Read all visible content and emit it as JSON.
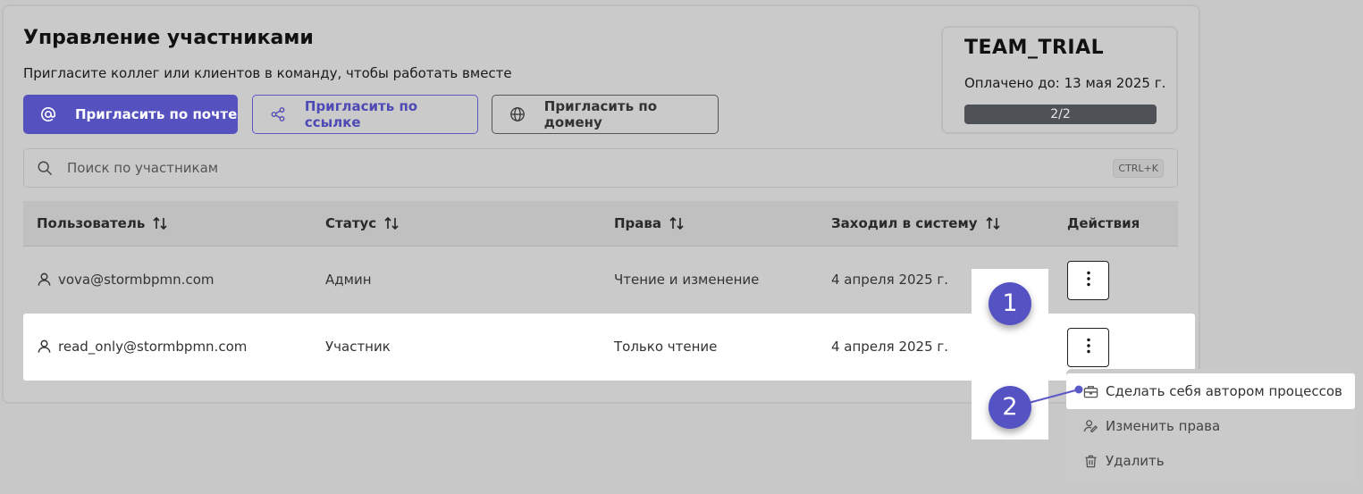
{
  "header": {
    "title": "Управление участниками",
    "subtitle": "Пригласите коллег или клиентов в команду, чтобы работать вместе"
  },
  "invite": {
    "email_label": "Пригласить по почте",
    "link_label": "Пригласить по ссылке",
    "domain_label": "Пригласить по домену"
  },
  "plan": {
    "name": "TEAM_TRIAL",
    "paid_until": "Оплачено до: 13 мая 2025 г.",
    "seats": "2/2"
  },
  "search": {
    "placeholder": "Поиск по участникам",
    "shortcut": "CTRL+K"
  },
  "table": {
    "columns": [
      "Пользователь",
      "Статус",
      "Права",
      "Заходил в систему",
      "Действия"
    ],
    "rows": [
      {
        "user": "vova@stormbpmn.com",
        "status": "Админ",
        "rights": "Чтение и изменение",
        "last_login": "4 апреля 2025 г."
      },
      {
        "user": "read_only@stormbpmn.com",
        "status": "Участник",
        "rights": "Только чтение",
        "last_login": "4 апреля 2025 г."
      }
    ]
  },
  "menu": {
    "items": [
      {
        "label": "Сделать себя автором процессов",
        "icon": "briefcase-icon"
      },
      {
        "label": "Изменить права",
        "icon": "user-edit-icon"
      },
      {
        "label": "Удалить",
        "icon": "trash-icon"
      }
    ]
  },
  "markers": [
    "1",
    "2"
  ],
  "colors": {
    "accent": "#5552c0",
    "background": "#c8c8c8",
    "plan_bar": "#4e5156"
  }
}
